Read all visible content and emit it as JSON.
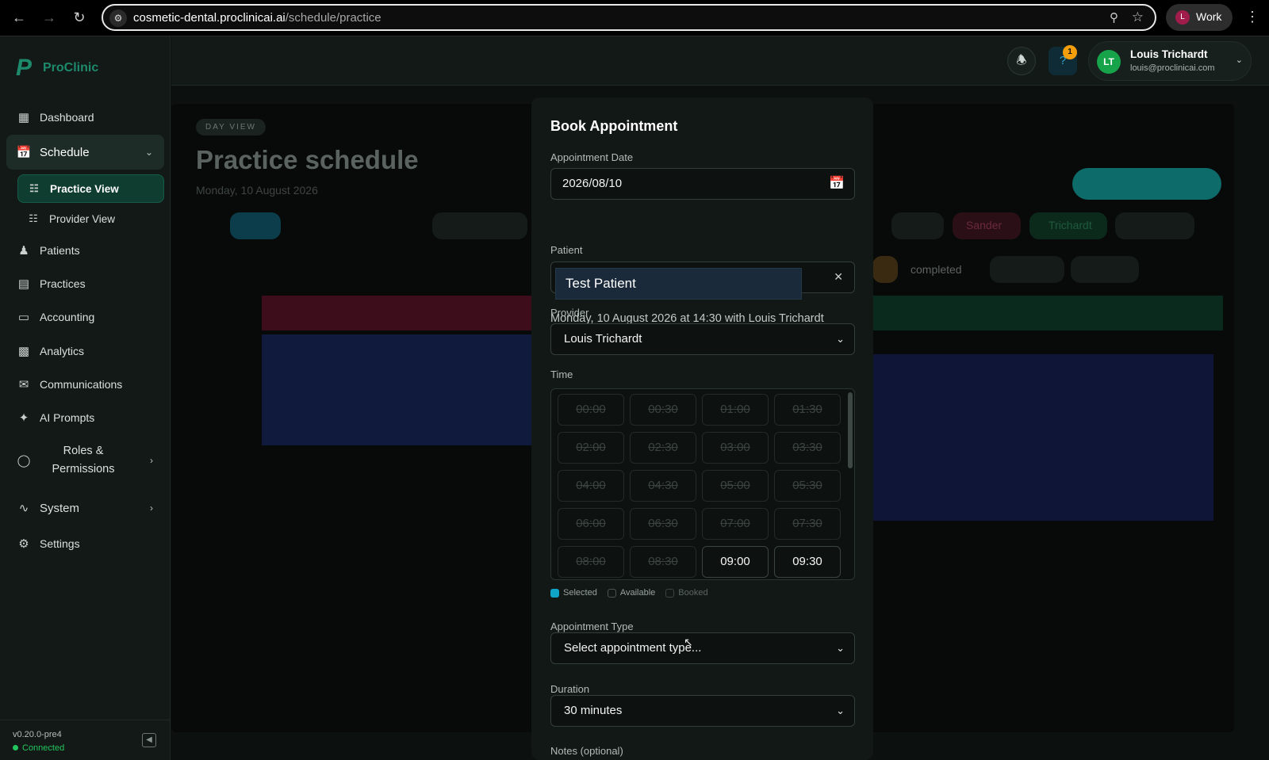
{
  "browser": {
    "url_host": "cosmetic-dental.proclinicai.ai",
    "url_path": "/schedule/practice",
    "profile_label": "Work",
    "profile_initial": "L"
  },
  "sidebar": {
    "brand": "ProClinic",
    "items": [
      {
        "label": "Dashboard",
        "icon": "grid-icon"
      },
      {
        "label": "Schedule",
        "icon": "calendar-icon"
      },
      {
        "label": "Practice View",
        "icon": "calendar-icon"
      },
      {
        "label": "Provider View",
        "icon": "calendar-icon"
      },
      {
        "label": "Patients",
        "icon": "users-icon"
      },
      {
        "label": "Practices",
        "icon": "building-icon"
      },
      {
        "label": "Accounting",
        "icon": "card-icon"
      },
      {
        "label": "Analytics",
        "icon": "bar-chart-icon"
      },
      {
        "label": "Communications",
        "icon": "mail-icon"
      },
      {
        "label": "AI Prompts",
        "icon": "sparkles-icon"
      },
      {
        "label": "Roles & Permissions",
        "icon": "shield-icon"
      },
      {
        "label": "System",
        "icon": "activity-icon"
      },
      {
        "label": "Settings",
        "icon": "gear-icon"
      }
    ],
    "version": "v0.20.0-pre4",
    "status": "Connected"
  },
  "header": {
    "notifications_badge": "1",
    "user_initials": "LT",
    "user_name": "Louis Trichardt",
    "user_email": "louis@proclinicai.com"
  },
  "background": {
    "chip": "DAY VIEW",
    "title": "Practice schedule",
    "subtitle": "Monday, 10 August 2026",
    "tags": [
      "Sander",
      "Trichardt",
      "completed"
    ]
  },
  "modal": {
    "title": "Book Appointment",
    "date_label": "Appointment Date",
    "date_value": "2026/08/10",
    "summary": "Monday, 10 August 2026 at 14:30 with Louis Trichardt",
    "patient_label": "Patient",
    "patient_suggestion": "Test Patient",
    "provider_label": "Provider",
    "provider_value": "Louis Trichardt",
    "time_label": "Time",
    "slots": [
      {
        "time": "00:00",
        "available": false
      },
      {
        "time": "00:30",
        "available": false
      },
      {
        "time": "01:00",
        "available": false
      },
      {
        "time": "01:30",
        "available": false
      },
      {
        "time": "02:00",
        "available": false
      },
      {
        "time": "02:30",
        "available": false
      },
      {
        "time": "03:00",
        "available": false
      },
      {
        "time": "03:30",
        "available": false
      },
      {
        "time": "04:00",
        "available": false
      },
      {
        "time": "04:30",
        "available": false
      },
      {
        "time": "05:00",
        "available": false
      },
      {
        "time": "05:30",
        "available": false
      },
      {
        "time": "06:00",
        "available": false
      },
      {
        "time": "06:30",
        "available": false
      },
      {
        "time": "07:00",
        "available": false
      },
      {
        "time": "07:30",
        "available": false
      },
      {
        "time": "08:00",
        "available": false
      },
      {
        "time": "08:30",
        "available": false
      },
      {
        "time": "09:00",
        "available": true
      },
      {
        "time": "09:30",
        "available": true
      }
    ],
    "legend": {
      "selected": "Selected",
      "available": "Available",
      "booked": "Booked"
    },
    "type_label": "Appointment Type",
    "type_placeholder": "Select appointment type...",
    "duration_label": "Duration",
    "duration_value": "30 minutes",
    "notes_label": "Notes (optional)"
  },
  "colors": {
    "accent": "#1d8a6c",
    "selected": "#0ea5c9",
    "connected": "#22c55e"
  }
}
